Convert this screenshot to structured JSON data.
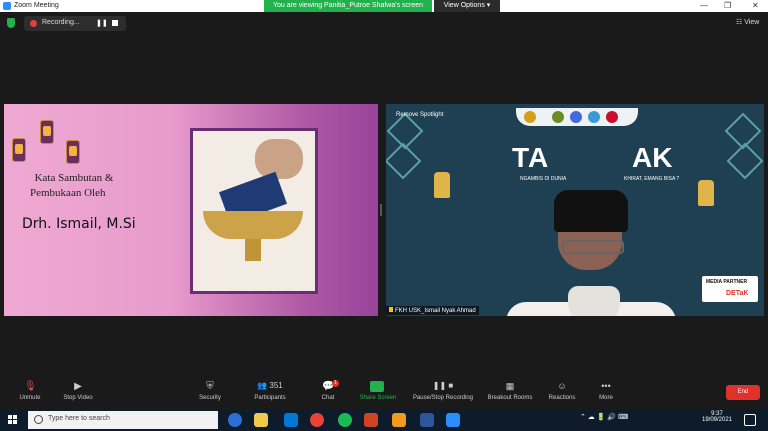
{
  "window": {
    "title": "Zoom Meeting",
    "viewing_banner": "You are viewing Panitia_Putroe Shafwa's screen",
    "view_options": "View Options",
    "view_button": "View"
  },
  "recording": {
    "status": "Recording..."
  },
  "slide": {
    "line1": "Kata Sambutan &",
    "line2": "Pembukaan Oleh",
    "name": "Drh. Ismail, M.Si"
  },
  "video": {
    "remove_spotlight": "Remove Spotlight",
    "headline_left": "TA",
    "headline_right": "AK",
    "tagline_left": "NGAMBIS DI DUNIA",
    "tagline_right": "KHIRAT, EMANG BISA ?",
    "media_partner": "MEDIA PARTNER",
    "media_brand": "DETaK",
    "participant_name": "FKH USK_Ismail Nyak Ahmad"
  },
  "toolbar": {
    "unmute": "Unmute",
    "stop_video": "Stop Video",
    "security": "Security",
    "participants": "Participants",
    "participants_count": "351",
    "chat": "Chat",
    "chat_badge": "1",
    "share_screen": "Share Screen",
    "pause_stop_recording": "Pause/Stop Recording",
    "breakout_rooms": "Breakout Rooms",
    "reactions": "Reactions",
    "more": "More",
    "end": "End"
  },
  "taskbar": {
    "search_placeholder": "Type here to search",
    "time": "9:37",
    "date": "19/09/2021"
  },
  "colors": {
    "zoom_blue": "#2d8cff",
    "green": "#23b14d",
    "end_red": "#e0312d"
  }
}
